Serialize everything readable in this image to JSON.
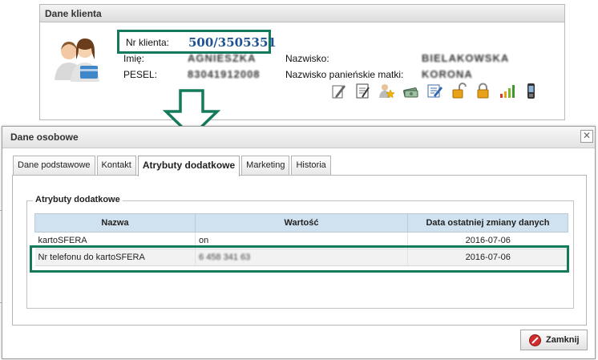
{
  "client_panel": {
    "title": "Dane klienta",
    "client_number_label": "Nr klienta:",
    "client_number": "500/3505351",
    "first_name_label": "Imię:",
    "first_name_value": "AGNIESZKA",
    "pesel_label": "PESEL:",
    "pesel_value": "83041912008",
    "last_name_label": "Nazwisko:",
    "last_name_value": "BIELAKOWSKA",
    "maiden_name_label": "Nazwisko panieńskie matki:",
    "maiden_name_value": "KORONA",
    "toolbar_icons": [
      "pencil-icon",
      "notepad-icon",
      "user-star-icon",
      "money-icon",
      "edit-form-icon",
      "unlock-icon",
      "lock-icon",
      "signal-bars-icon",
      "mobile-phone-icon"
    ]
  },
  "dialog": {
    "title": "Dane osobowe",
    "close_glyph": "✕",
    "tabs": [
      {
        "label": "Dane podstawowe",
        "active": false
      },
      {
        "label": "Kontakt",
        "active": false
      },
      {
        "label": "Atrybuty dodatkowe",
        "active": true
      },
      {
        "label": "Marketing",
        "active": false
      },
      {
        "label": "Historia",
        "active": false
      }
    ],
    "section_title": "Atrybuty dodatkowe",
    "table": {
      "headers": [
        "Nazwa",
        "Wartość",
        "Data ostatniej zmiany danych"
      ],
      "rows": [
        {
          "name": "kartoSFERA",
          "value": "on",
          "date": "2016-07-06"
        },
        {
          "name": "Nr telefonu do kartoSFERA",
          "value": "6 458 341 63",
          "date": "2016-07-06"
        }
      ]
    },
    "close_button_label": "Zamknij"
  },
  "colors": {
    "highlight": "#137a5c",
    "client_number": "#1d5394",
    "table_header": "#d0e2ef"
  }
}
